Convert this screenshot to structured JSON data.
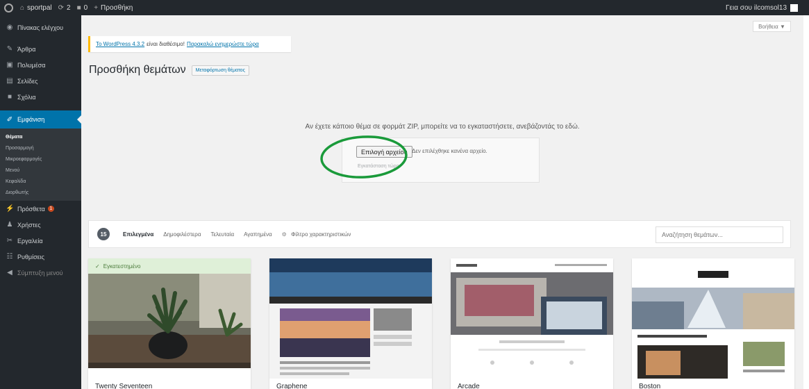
{
  "adminbar": {
    "site_name": "sportpal",
    "updates_count": "2",
    "comments_count": "0",
    "new_label": "Προσθήκη",
    "howdy": "Γεια σου ilcomsol13"
  },
  "sidebar": {
    "items": [
      {
        "label": "Πίνακας ελέγχου",
        "icon": "dashboard-icon"
      },
      {
        "label": "Άρθρα",
        "icon": "pin-icon"
      },
      {
        "label": "Πολυμέσα",
        "icon": "media-icon"
      },
      {
        "label": "Σελίδες",
        "icon": "page-icon"
      },
      {
        "label": "Σχόλια",
        "icon": "comment-icon"
      }
    ],
    "current": {
      "label": "Εμφάνιση",
      "icon": "brush-icon"
    },
    "submenu": [
      "Θέματα",
      "Προσαρμογή",
      "Μικροεφαρμογές",
      "Μενού",
      "Κεφαλίδα",
      "Διορθωτής"
    ],
    "items_after": [
      {
        "label": "Πρόσθετα",
        "icon": "plugin-icon",
        "badge": "1"
      },
      {
        "label": "Χρήστες",
        "icon": "users-icon"
      },
      {
        "label": "Εργαλεία",
        "icon": "tools-icon"
      },
      {
        "label": "Ρυθμίσεις",
        "icon": "settings-icon"
      },
      {
        "label": "Σύμπτυξη μενού",
        "icon": "collapse-icon"
      }
    ]
  },
  "help_tab": "Βοήθεια ▼",
  "notice": {
    "link1": "Το WordPress 4.3.2",
    "middle": "είναι διαθέσιμο!",
    "link2": "Παρακαλώ ενημερώστε τώρα"
  },
  "page_title": "Προσθήκη θεμάτων",
  "upload_toggle": "Μεταφόρτωση θέματος",
  "upload": {
    "hint": "Αν έχετε κάποιο θέμα σε φορμάτ ZIP, μπορείτε να το εγκαταστήσετε, ανεβάζοντάς το εδώ.",
    "choose_file": "Επιλογή αρχείου",
    "no_file": "Δεν επιλέχθηκε κανένα αρχείο.",
    "install": "Εγκατάσταση τώρα"
  },
  "filters": {
    "count": "15",
    "links": [
      "Επιλεγμένα",
      "Δημοφιλέστερα",
      "Τελευταία",
      "Αγαπημένα"
    ],
    "feature_filter": "Φίλτρο χαρακτηριστικών",
    "search_placeholder": "Αναζήτηση θεμάτων..."
  },
  "themes": [
    {
      "name": "Twenty Seventeen",
      "installed": "Εγκατεστημένο"
    },
    {
      "name": "Graphene"
    },
    {
      "name": "Arcade"
    },
    {
      "name": "Boston"
    }
  ],
  "colors": {
    "admin_dark": "#23282d",
    "accent_blue": "#0073aa",
    "annotation_green": "#1a9a3a",
    "notice_yellow": "#ffba00"
  }
}
